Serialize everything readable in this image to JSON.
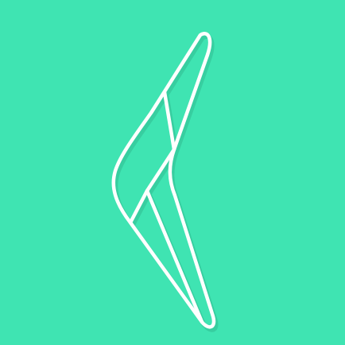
{
  "icon": {
    "name": "boomerang-icon",
    "background_color": "#3FE4B2",
    "stroke_color": "#FFFFFF",
    "shadow_color": "#2FB58C"
  }
}
